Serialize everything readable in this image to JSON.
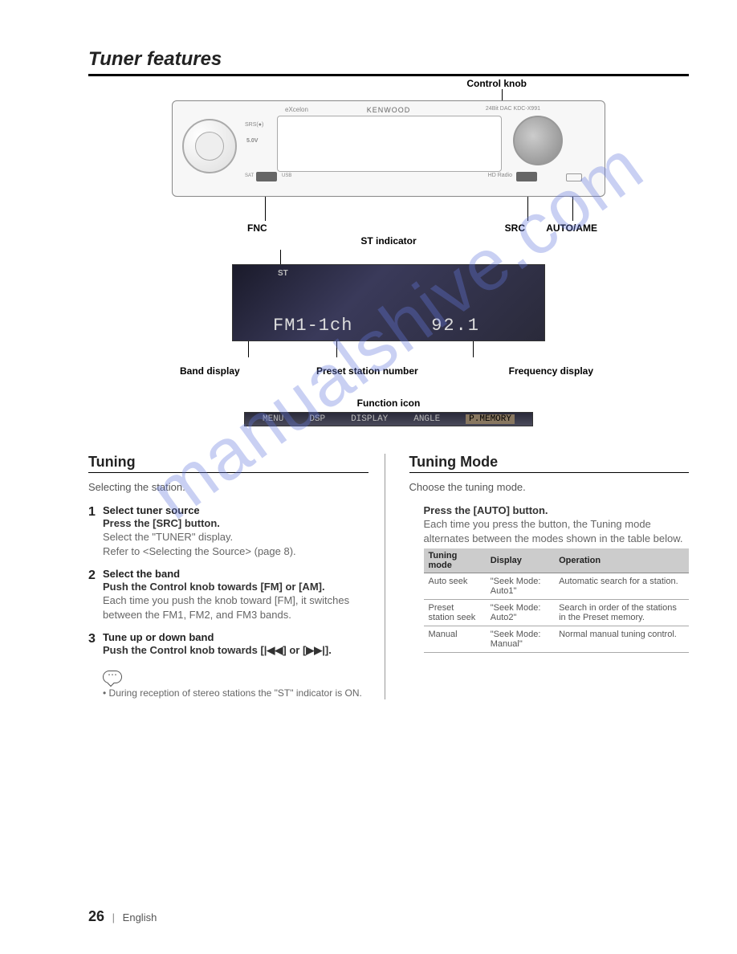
{
  "page_title": "Tuner features",
  "watermark": "manualshive.com",
  "diagram": {
    "brand": "KENWOOD",
    "series": "eXcelon",
    "model_badge": "24Bit DAC   KDC-X991",
    "callout_knob": "Control knob",
    "callout_fnc": "FNC",
    "callout_src": "SRC",
    "callout_auto": "AUTO/AME",
    "callout_st": "ST indicator",
    "callout_band": "Band display",
    "callout_preset": "Preset station number",
    "callout_freq": "Frequency display",
    "callout_funcicon": "Function icon",
    "label_srs": "SRS(●)",
    "label_5v": "5.0V",
    "label_usb": "USB",
    "label_sat": "SAT",
    "label_hd": "HD Radio",
    "lcd": {
      "st": "ST",
      "band_text": "FM1-1ch",
      "freq_text": "92.1"
    },
    "funcbar": {
      "items": [
        "MENU",
        "DSP",
        "DISPLAY",
        "ANGLE",
        "P.MEMORY"
      ]
    }
  },
  "left": {
    "heading": "Tuning",
    "intro": "Selecting the station.",
    "step1": {
      "num": "1",
      "title": "Select tuner source",
      "action": "Press the [SRC] button.",
      "desc1": "Select the \"TUNER\" display.",
      "desc2": "Refer to <Selecting the Source> (page 8)."
    },
    "step2": {
      "num": "2",
      "title": "Select the band",
      "action": "Push the Control knob towards [FM] or [AM].",
      "desc": "Each time you push the knob toward [FM], it switches between the FM1, FM2, and FM3 bands."
    },
    "step3": {
      "num": "3",
      "title": "Tune up or down band",
      "action": "Push the Control knob towards [|◀◀] or [▶▶|]."
    },
    "note": "During reception of stereo stations the \"ST\" indicator is ON."
  },
  "right": {
    "heading": "Tuning Mode",
    "intro": "Choose the tuning mode.",
    "action": "Press the [AUTO] button.",
    "desc": "Each time you press the button, the Tuning mode alternates between the modes shown in the table below.",
    "table": {
      "headers": [
        "Tuning mode",
        "Display",
        "Operation"
      ],
      "rows": [
        {
          "mode": "Auto seek",
          "display": "\"Seek Mode: Auto1\"",
          "op": "Automatic search for a station."
        },
        {
          "mode": "Preset station seek",
          "display": "\"Seek Mode: Auto2\"",
          "op": "Search in order of the stations in the Preset memory."
        },
        {
          "mode": "Manual",
          "display": "\"Seek Mode: Manual\"",
          "op": "Normal manual tuning control."
        }
      ]
    }
  },
  "footer": {
    "page": "26",
    "lang": "English"
  }
}
